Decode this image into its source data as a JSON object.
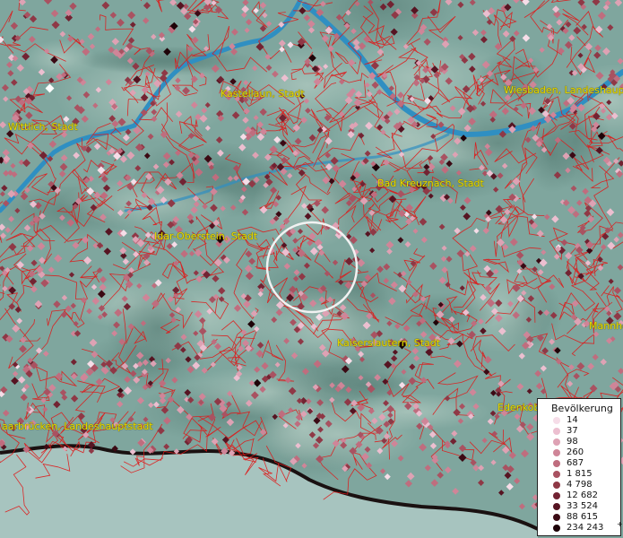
{
  "map": {
    "cities": [
      {
        "id": "kastellaun",
        "label": "Kastellaun, Stadt"
      },
      {
        "id": "wiesbaden",
        "label": "Wiesbaden, Landeshauptstadt"
      },
      {
        "id": "wittlich",
        "label": "Wittlich, Stadt"
      },
      {
        "id": "bad-kreuznach",
        "label": "Bad Kreuznach, Stadt"
      },
      {
        "id": "idar-oberstein",
        "label": "Idar-Oberstein, Stadt"
      },
      {
        "id": "mannheim",
        "label": "Mannhei"
      },
      {
        "id": "kaiserslautern",
        "label": "Kaiserslautern, Stadt"
      },
      {
        "id": "saarbruecken",
        "label": "aarbrücken, Landeshauptstadt"
      },
      {
        "id": "edenkoben",
        "label": "Edenkob"
      }
    ],
    "colors": {
      "background": "#7fa69e",
      "boundary": "#e01818",
      "river": "#2f8fc2",
      "city_label": "#e8dc00",
      "selection_circle": "#f2f2f2"
    }
  },
  "legend": {
    "title": "Bevölkerung",
    "items": [
      {
        "label": "14",
        "color": "#f6dde8"
      },
      {
        "label": "37",
        "color": "#ecbfd0"
      },
      {
        "label": "98",
        "color": "#dea2b4"
      },
      {
        "label": "260",
        "color": "#cf8598"
      },
      {
        "label": "687",
        "color": "#bf6d7e"
      },
      {
        "label": "1 815",
        "color": "#a95261"
      },
      {
        "label": "4 798",
        "color": "#8f3846"
      },
      {
        "label": "12 682",
        "color": "#722332"
      },
      {
        "label": "33 524",
        "color": "#561422"
      },
      {
        "label": "88 615",
        "color": "#3b0a14"
      },
      {
        "label": "234 243",
        "color": "#1e0308"
      }
    ],
    "overflow_mark": "+"
  }
}
